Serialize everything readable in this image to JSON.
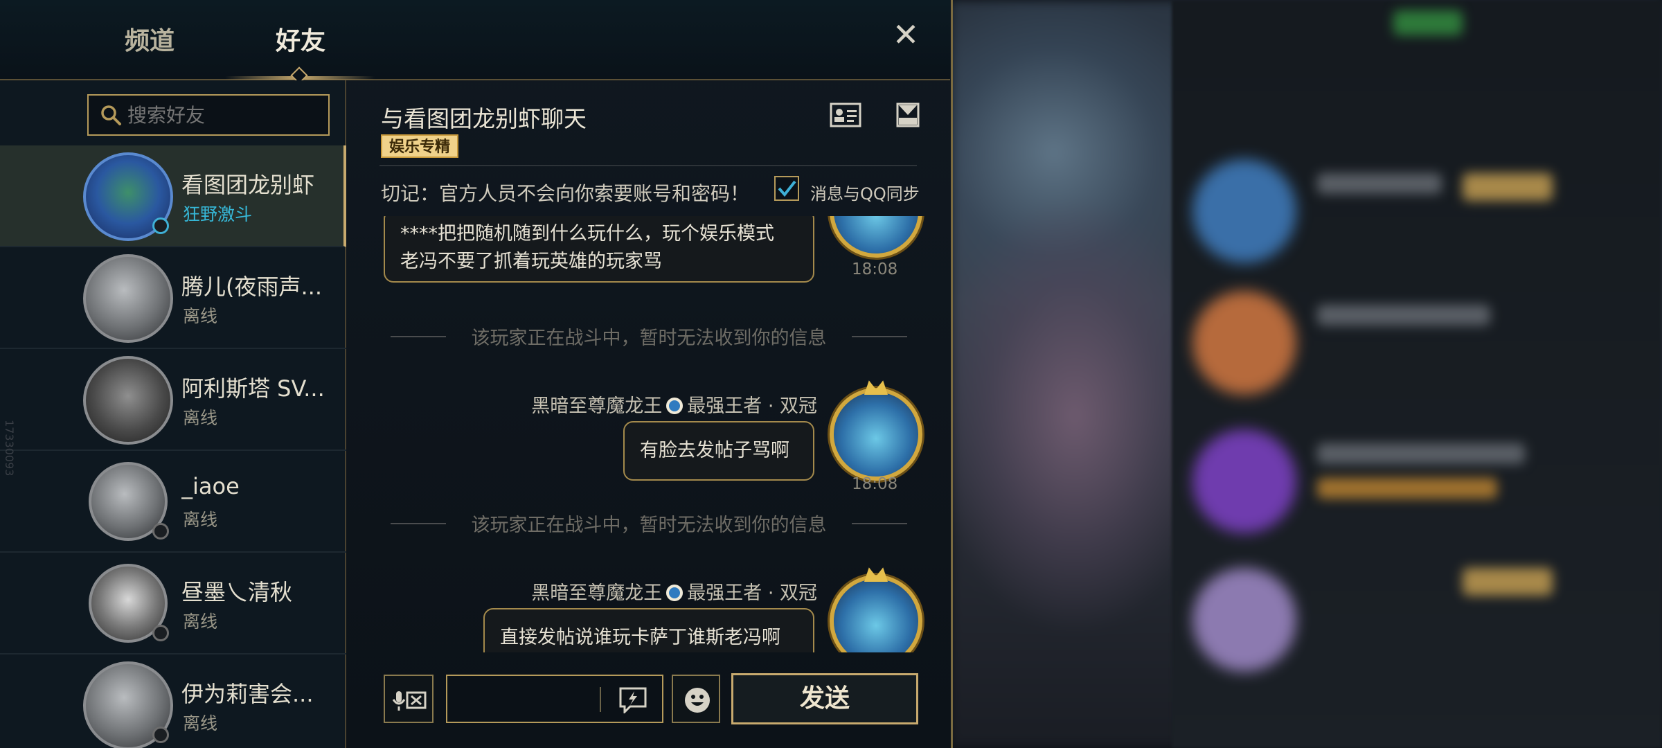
{
  "tabs": {
    "channel": "频道",
    "friends": "好友"
  },
  "search": {
    "placeholder": "搜索好友"
  },
  "friends": [
    {
      "name": "看图团龙别虾",
      "status": "狂野激斗",
      "online": true
    },
    {
      "name": "腾儿(夜雨声...",
      "status": "离线",
      "online": false
    },
    {
      "name": "阿利斯塔 SV...",
      "status": "离线",
      "online": false
    },
    {
      "name": "_iaoe",
      "status": "离线",
      "online": false
    },
    {
      "name": "昼墨乀清秋",
      "status": "离线",
      "online": false
    },
    {
      "name": "伊为莉害会...",
      "status": "离线",
      "online": false
    }
  ],
  "side_watermark": "17330093",
  "chat": {
    "title": "与看图团龙别虾聊天",
    "tag": "娱乐专精",
    "warning": "切记：官方人员不会向你索要账号和密码！",
    "sync_label": "消息与QQ同步",
    "sync_checked": true,
    "messages": {
      "m1_line1": "****把把随机随到什么玩什么，玩个娱乐模式",
      "m1_line2": "老冯不要了抓着玩英雄的玩家骂",
      "m1_time": "18:08",
      "sys1": "该玩家正在战斗中，暂时无法收到你的信息",
      "sender2_name": "黑暗至尊魔龙王",
      "sender2_rank": "最强王者 · 双冠",
      "m2_text": "有脸去发帖子骂啊",
      "m2_time": "18:08",
      "sys2": "该玩家正在战斗中，暂时无法收到你的信息",
      "sender3_name": "黑暗至尊魔龙王",
      "sender3_rank": "最强王者 · 双冠",
      "m3_text": "直接发帖说谁玩卡萨丁谁斯老冯啊"
    }
  },
  "input": {
    "value": "",
    "send_label": "发送"
  },
  "icons": {
    "search": "search-icon",
    "close": "close-icon",
    "profile_card": "profile-card-icon",
    "mail": "mail-icon",
    "voice": "voice-to-text-icon",
    "quick_message": "quick-message-icon",
    "emoji": "emoji-icon"
  },
  "colors": {
    "accent_gold": "#c8aa6e",
    "online_blue": "#36b8d8",
    "tag_bg": "#f0d28a"
  }
}
